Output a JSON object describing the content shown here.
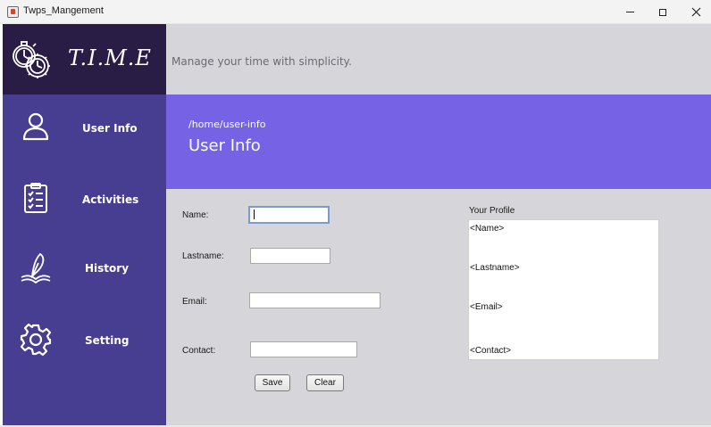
{
  "window": {
    "title": "Twps_Mangement",
    "controls": {
      "minimize": "minimize-icon",
      "maximize": "maximize-icon",
      "close": "close-icon"
    }
  },
  "brand": {
    "logo_text": "T.I.M.E",
    "logo_icon": "stopwatch-gear-icon",
    "tagline": "Manage your time with simplicity."
  },
  "sidebar": {
    "items": [
      {
        "label": "User Info",
        "icon": "user-icon"
      },
      {
        "label": "Activities",
        "icon": "clipboard-checklist-icon"
      },
      {
        "label": "History",
        "icon": "quill-book-icon"
      },
      {
        "label": "Setting",
        "icon": "gear-icon"
      }
    ]
  },
  "banner": {
    "breadcrumb": "/home/user-info",
    "title": "User Info"
  },
  "form": {
    "name_label": "Name:",
    "name_value": "",
    "lastname_label": "Lastname:",
    "lastname_value": "",
    "email_label": "Email:",
    "email_value": "",
    "contact_label": "Contact:",
    "contact_value": "",
    "save_label": "Save",
    "clear_label": "Clear"
  },
  "profile": {
    "title": "Your Profile",
    "name": "<Name>",
    "lastname": "<Lastname>",
    "email": "<Email>",
    "contact": "<Contact>"
  },
  "colors": {
    "sidebar": "#473d91",
    "logo_bg": "#2a1d45",
    "banner": "#7562e4",
    "content_bg": "#d6d6da"
  }
}
